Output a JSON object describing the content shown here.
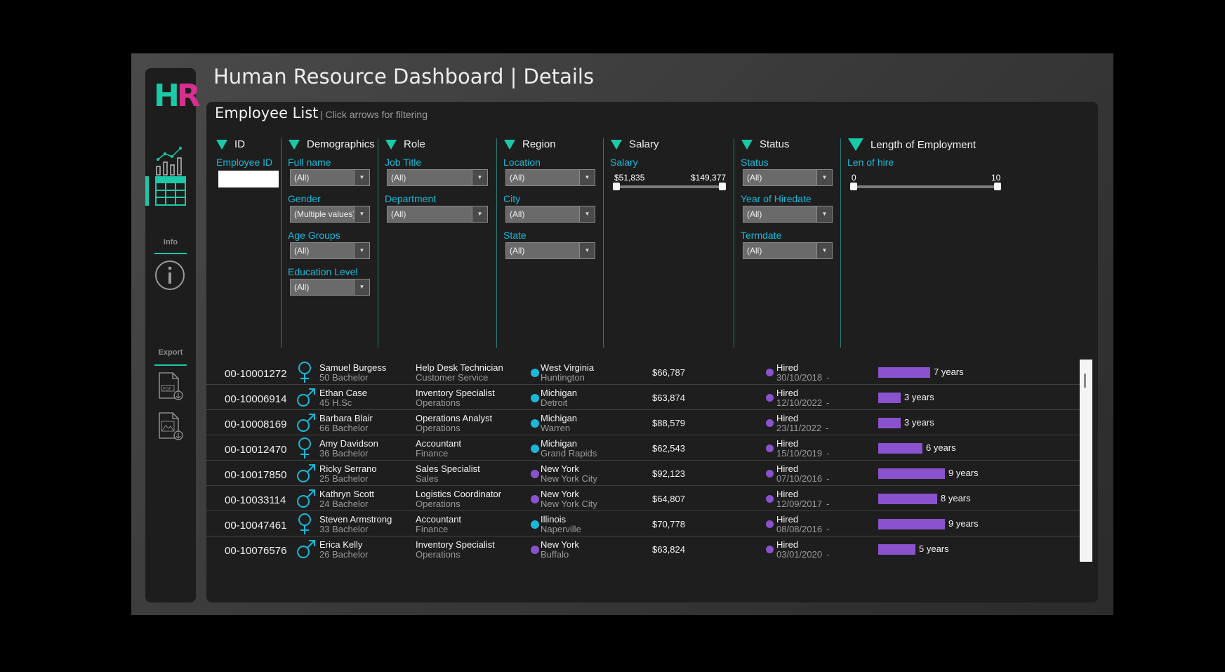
{
  "app": {
    "logo_h": "H",
    "logo_r": "R",
    "title": "Human Resource Dashboard | Details",
    "brand_colors": {
      "teal": "#1ac9a8",
      "magenta": "#d72f8d",
      "cyan": "#1ab8d8",
      "purple": "#8a52cc"
    }
  },
  "sidebar": {
    "nav": [
      {
        "icon": "chart-icon",
        "active": false
      },
      {
        "icon": "table-icon",
        "active": true
      }
    ],
    "info_label": "Info",
    "info_icon": "info-icon",
    "export_label": "Export",
    "export_icons": [
      "pdf-export-icon",
      "image-export-icon"
    ]
  },
  "list": {
    "title": "Employee List",
    "subtitle": "| Click arrows for filtering"
  },
  "filters": {
    "id": {
      "name": "ID",
      "employee_id_label": "Employee ID",
      "employee_id_value": ""
    },
    "demographics": {
      "name": "Demographics",
      "full_name_label": "Full name",
      "full_name_value": "(All)",
      "gender_label": "Gender",
      "gender_value": "(Multiple values)",
      "age_label": "Age Groups",
      "age_value": "(All)",
      "education_label": "Education Level",
      "education_value": "(All)"
    },
    "role": {
      "name": "Role",
      "job_label": "Job Title",
      "job_value": "(All)",
      "department_label": "Department",
      "department_value": "(All)"
    },
    "region": {
      "name": "Region",
      "location_label": "Location",
      "location_value": "(All)",
      "city_label": "City",
      "city_value": "(All)",
      "state_label": "State",
      "state_value": "(All)"
    },
    "salary": {
      "name": "Salary",
      "label": "Salary",
      "min": "$51,835",
      "max": "$149,377"
    },
    "status": {
      "name": "Status",
      "status_label": "Status",
      "status_value": "(All)",
      "year_label": "Year of Hiredate",
      "year_value": "(All)",
      "term_label": "Termdate",
      "term_value": "(All)"
    },
    "length": {
      "name": "Length of Employment",
      "label": "Len of hire",
      "min": "0",
      "max": "10"
    }
  },
  "employees": [
    {
      "id": "00-10001272",
      "gender": "female",
      "name": "Samuel Burgess",
      "detail": "50 Bachelor",
      "job": "Help Desk Technician",
      "dept": "Customer Service",
      "loc": "hq",
      "state": "West Virginia",
      "city": "Huntington",
      "salary": "$66,787",
      "status": "Hired",
      "hire_date": "30/10/2018",
      "dash": "-",
      "years": 7,
      "years_label": "7 years"
    },
    {
      "id": "00-10006914",
      "gender": "male",
      "name": "Ethan Case",
      "detail": "45 H.Sc",
      "job": "Inventory Specialist",
      "dept": "Operations",
      "loc": "hq",
      "state": "Michigan",
      "city": "Detroit",
      "salary": "$63,874",
      "status": "Hired",
      "hire_date": "12/10/2022",
      "dash": "-",
      "years": 3,
      "years_label": "3 years"
    },
    {
      "id": "00-10008169",
      "gender": "male",
      "name": "Barbara Blair",
      "detail": "66 Bachelor",
      "job": "Operations Analyst",
      "dept": "Operations",
      "loc": "hq",
      "state": "Michigan",
      "city": "Warren",
      "salary": "$88,579",
      "status": "Hired",
      "hire_date": "23/11/2022",
      "dash": "-",
      "years": 3,
      "years_label": "3 years"
    },
    {
      "id": "00-10012470",
      "gender": "female",
      "name": "Amy Davidson",
      "detail": "36 Bachelor",
      "job": "Accountant",
      "dept": "Finance",
      "loc": "hq",
      "state": "Michigan",
      "city": "Grand Rapids",
      "salary": "$62,543",
      "status": "Hired",
      "hire_date": "15/10/2019",
      "dash": "-",
      "years": 6,
      "years_label": "6 years"
    },
    {
      "id": "00-10017850",
      "gender": "male",
      "name": "Ricky Serrano",
      "detail": "25 Bachelor",
      "job": "Sales Specialist",
      "dept": "Sales",
      "loc": "branch",
      "state": "New York",
      "city": "New York City",
      "salary": "$92,123",
      "status": "Hired",
      "hire_date": "07/10/2016",
      "dash": "-",
      "years": 9,
      "years_label": "9 years"
    },
    {
      "id": "00-10033114",
      "gender": "male",
      "name": "Kathryn Scott",
      "detail": "24 Bachelor",
      "job": "Logistics Coordinator",
      "dept": "Operations",
      "loc": "branch",
      "state": "New York",
      "city": "New York City",
      "salary": "$64,807",
      "status": "Hired",
      "hire_date": "12/09/2017",
      "dash": "-",
      "years": 8,
      "years_label": "8 years"
    },
    {
      "id": "00-10047461",
      "gender": "female",
      "name": "Steven Armstrong",
      "detail": "33 Bachelor",
      "job": "Accountant",
      "dept": "Finance",
      "loc": "hq",
      "state": "Illinois",
      "city": "Naperville",
      "salary": "$70,778",
      "status": "Hired",
      "hire_date": "08/08/2016",
      "dash": "-",
      "years": 9,
      "years_label": "9 years"
    },
    {
      "id": "00-10076576",
      "gender": "male",
      "name": "Erica Kelly",
      "detail": "26 Bachelor",
      "job": "Inventory Specialist",
      "dept": "Operations",
      "loc": "branch",
      "state": "New York",
      "city": "Buffalo",
      "salary": "$63,824",
      "status": "Hired",
      "hire_date": "03/01/2020",
      "dash": "-",
      "years": 5,
      "years_label": "5 years"
    }
  ]
}
